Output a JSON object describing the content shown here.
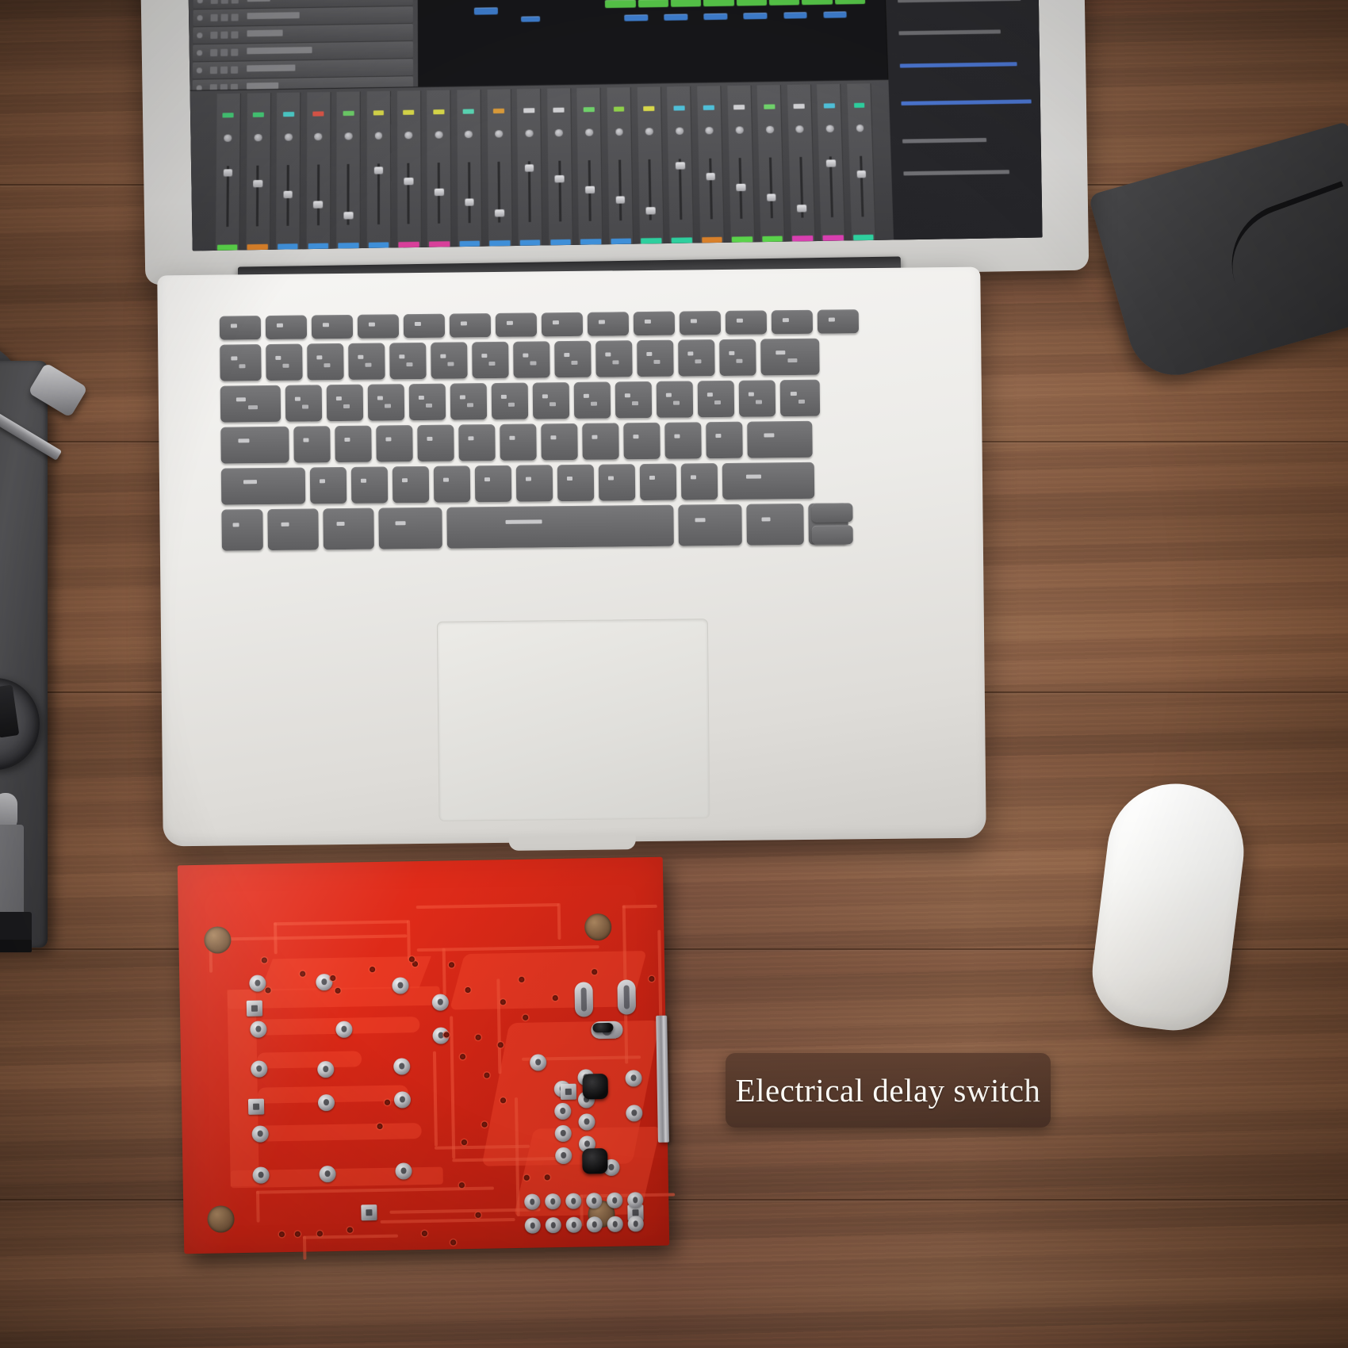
{
  "scene": {
    "title": "Electrical delay switch product photo",
    "surface": "wooden desk",
    "wood_color": "#7d5440",
    "vignette": true
  },
  "label": {
    "text": "Electrical delay switch",
    "background_color": "#5c3e2f",
    "text_color": "#fdfbf6",
    "name": "product-caption"
  },
  "laptop": {
    "name": "white laptop",
    "body_color": "#f1f0ed",
    "key_color": "#6e6e70",
    "screen": {
      "app": "digital audio workstation",
      "background_color": "#17171a",
      "ruler_color": "#a8962f",
      "region_colors": [
        "#d8442c",
        "#4e8fd6",
        "#2ecf9e",
        "#cfd84a",
        "#37c0e8",
        "#58c94a",
        "#3f7fd0"
      ],
      "tracks": 20,
      "mixer_channels": 22
    },
    "trackpad_color": "#e6e5e1"
  },
  "mouse": {
    "name": "white wireless mouse",
    "color": "#f8f8f6"
  },
  "turntable": {
    "name": "turntable",
    "body_color": "#4e4e51",
    "tonearm_color": "#c8c8cb"
  },
  "dark_object": {
    "name": "dark gray pad",
    "color": "#3c3c3e"
  },
  "pcb": {
    "name": "red printed circuit board",
    "board_color": "#d8291a",
    "copper_color": "#ef4028",
    "pad_color": "#c3c3c7",
    "mounting_holes": 4,
    "description": "electrical delay switch relay board, solder side"
  }
}
